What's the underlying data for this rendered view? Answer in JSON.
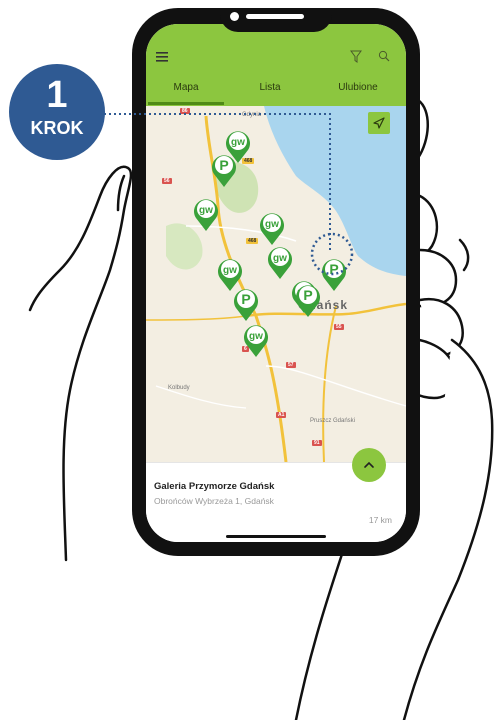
{
  "tabs": [
    {
      "label": "Mapa",
      "active": true
    },
    {
      "label": "Lista",
      "active": false
    },
    {
      "label": "Ulubione",
      "active": false
    }
  ],
  "header": {
    "menu_icon": "hamburger-menu-icon",
    "filter_icon": "filter-funnel-icon",
    "search_icon": "search-icon"
  },
  "step_badge": {
    "number": "1",
    "word": "KROK"
  },
  "map": {
    "city": "Gdańsk",
    "places": [
      "Kolbudy",
      "Pruszcz Gdański",
      "Gdynia"
    ],
    "route_numbers": [
      "86",
      "468",
      "56",
      "57",
      "55",
      "91",
      "A1",
      "6"
    ]
  },
  "location": {
    "title": "Galeria Przymorze Gdańsk",
    "address": "Obrońców Wybrzeża 1, Gdańsk",
    "distance": "17 km"
  },
  "colors": {
    "accent": "#8cc63f",
    "pin_green": "#3aa13a",
    "badge_blue": "#2f5a93",
    "sea": "#a9d5ee"
  }
}
